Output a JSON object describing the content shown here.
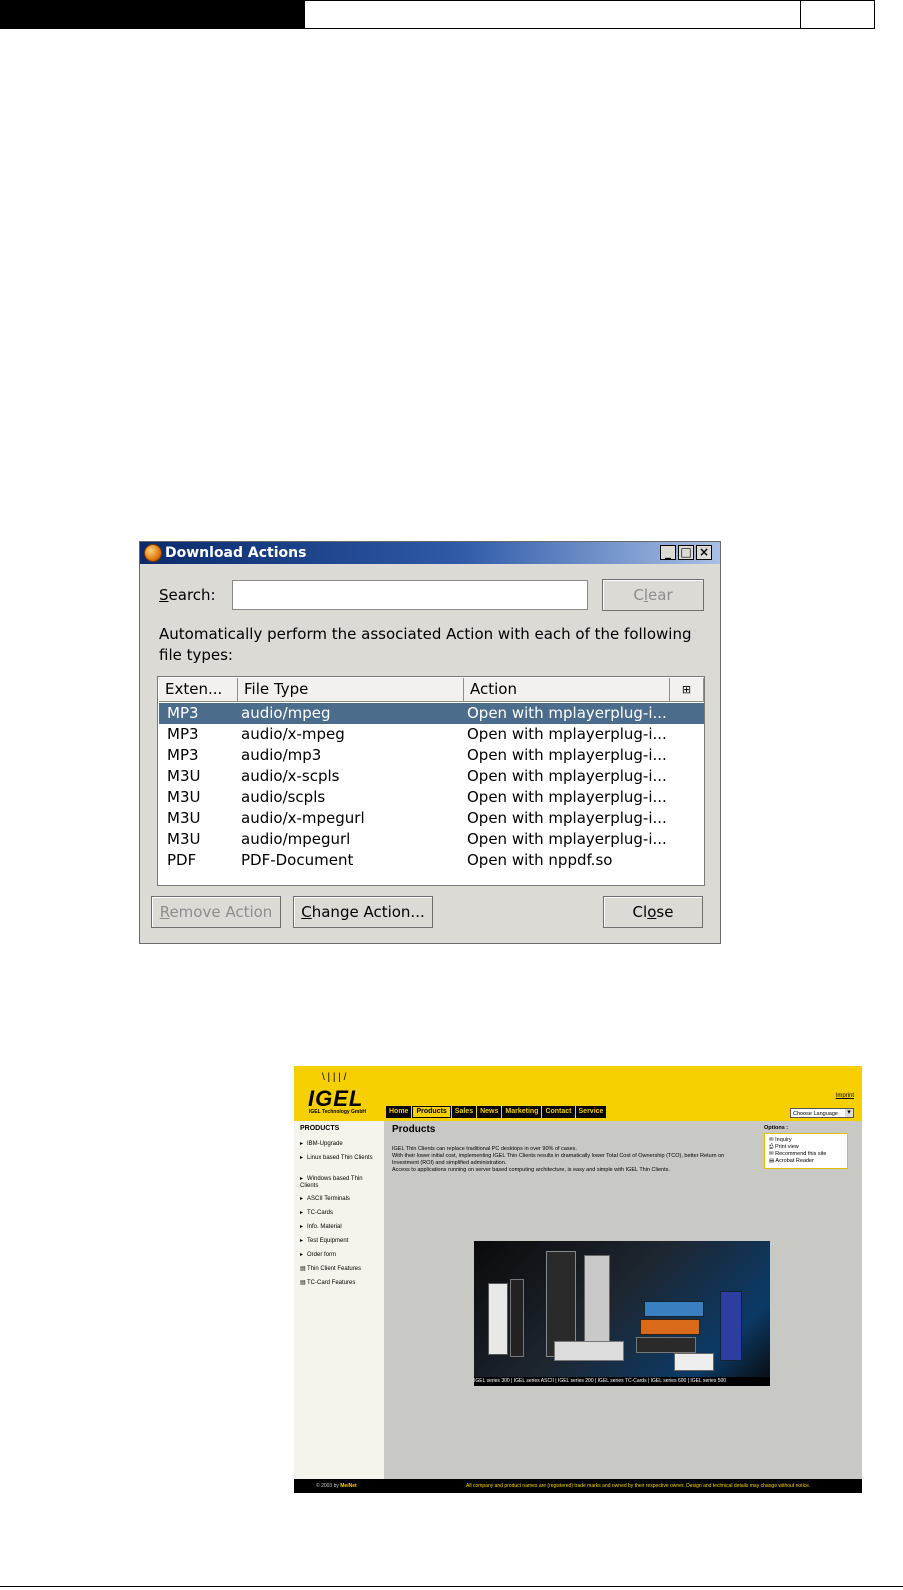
{
  "dialog": {
    "title": "Download Actions",
    "window_buttons": {
      "minimize": "_",
      "maximize": "□",
      "close": "×"
    },
    "search_label_prefix": "S",
    "search_label_rest": "earch:",
    "search_value": "",
    "clear_pre": "C",
    "clear_key": "l",
    "clear_post": "ear",
    "description": "Automatically perform the associated Action with each of the following file types:",
    "columns": {
      "extension": "Exten...",
      "file_type": "File Type",
      "action": "Action",
      "picker": "⊞"
    },
    "rows": [
      {
        "ext": "MP3",
        "type": "audio/mpeg",
        "action": "Open with mplayerplug-i...",
        "selected": true
      },
      {
        "ext": "MP3",
        "type": "audio/x-mpeg",
        "action": "Open with mplayerplug-i..."
      },
      {
        "ext": "MP3",
        "type": "audio/mp3",
        "action": "Open with mplayerplug-i..."
      },
      {
        "ext": "M3U",
        "type": "audio/x-scpls",
        "action": "Open with mplayerplug-i..."
      },
      {
        "ext": "M3U",
        "type": "audio/scpls",
        "action": "Open with mplayerplug-i..."
      },
      {
        "ext": "M3U",
        "type": "audio/x-mpegurl",
        "action": "Open with mplayerplug-i..."
      },
      {
        "ext": "M3U",
        "type": "audio/mpegurl",
        "action": "Open with mplayerplug-i..."
      },
      {
        "ext": "PDF",
        "type": "PDF-Document",
        "action": "Open with nppdf.so"
      }
    ],
    "remove_key": "R",
    "remove_rest": "emove Action",
    "change_key": "C",
    "change_rest": "hange Action...",
    "close_pre": "Cl",
    "close_key": "o",
    "close_post": "se",
    "colors": {
      "selection": "#4c6c8c",
      "face": "#dcdad5"
    }
  },
  "website": {
    "logo": "IGEL",
    "logo_sub": "IGEL Technology GmbH",
    "nav": [
      "Home",
      "Products",
      "Sales",
      "News",
      "Marketing",
      "Contact",
      "Service"
    ],
    "nav_active": "Products",
    "login": "Imprint",
    "language": "Choose Language",
    "sidebar_title": "PRODUCTS",
    "sidebar": [
      "IBM-Upgrade",
      "Linux based Thin Clients",
      "Windows based Thin Clients",
      "ASCII Terminals",
      "TC-Cards",
      "Info. Material",
      "Test Equipment",
      "Order form",
      "Thin Client Features",
      "TC-Card Features"
    ],
    "heading": "Products",
    "body": [
      "IGEL Thin Clients can replace traditional PC desktops in over 90% of cases.",
      "With their lower initial cost, implementing IGEL Thin Clients results in dramatically lower Total Cost of Ownership (TCO), better Return on Investment (ROI) and simplified administration.",
      "Access to applications running on server based computing architecture, is easy and simple with IGEL Thin Clients."
    ],
    "options_title": "Options :",
    "options": [
      "Inquiry",
      "Print view",
      "Recommend this site",
      "Acrobat Reader"
    ],
    "captions": "IGEL series 300 | IGEL series ASCII | IGEL series 200 | IGEL series TC-Cards | IGEL series 600 | IGEL series 500",
    "footer_left_pre": "© 2003 by ",
    "footer_left_brand": "MeiNet",
    "footer_right": "All company and product names are (registered) trade marks and owned by their respective owner. Design and technical details may change without notice.",
    "colors": {
      "brand_yellow": "#f6cf00",
      "main_bg": "#c8c8c4"
    }
  }
}
